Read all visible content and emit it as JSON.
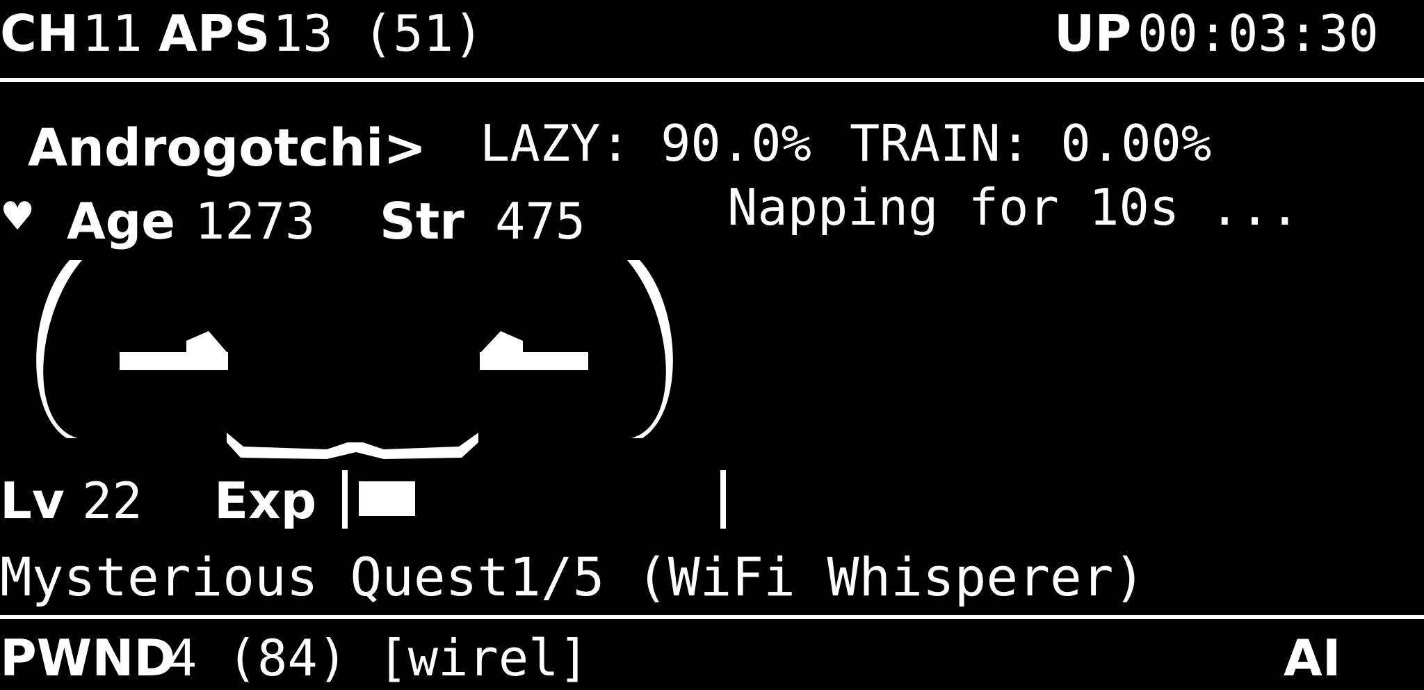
{
  "header": {
    "channel_label": "CH",
    "channel_value": "11",
    "aps_label": "APS",
    "aps_value": "13 (51)",
    "uptime_label": "UP",
    "uptime_value": "00:03:30"
  },
  "pet": {
    "name": "Androgotchi>",
    "lazy": "LAZY: 90.0%",
    "train": "TRAIN: 0.00%",
    "heart": "♥",
    "age_label": "Age",
    "age_value": "1273",
    "str_label": "Str",
    "str_value": "475",
    "status_message": "Napping for 10s ..."
  },
  "level": {
    "lv_label": "Lv",
    "lv_value": "22",
    "exp_label": "Exp",
    "exp_fraction": 0.16
  },
  "quest": {
    "text": "Mysterious Quest1/5 (WiFi Whisperer)"
  },
  "footer": {
    "pwnd_label": "PWND",
    "pwnd_value": "4 (84) [wirel]",
    "mode": "AI"
  },
  "colors": {
    "background": "#000000",
    "foreground": "#ffffff"
  }
}
